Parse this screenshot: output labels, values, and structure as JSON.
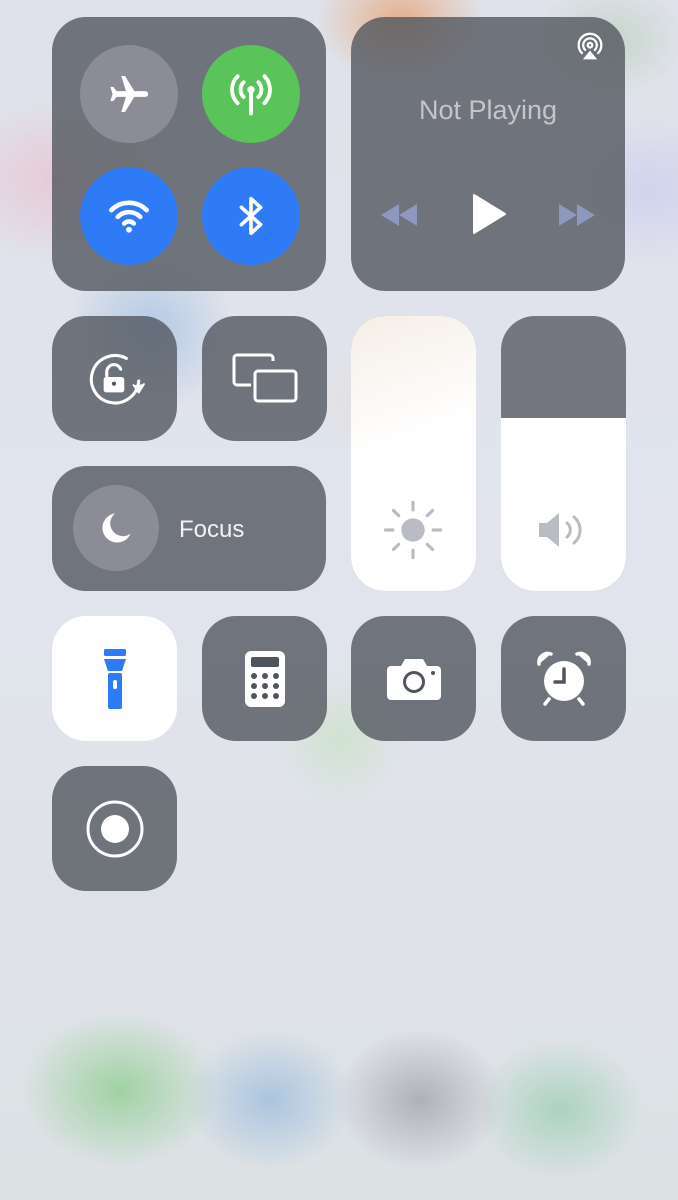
{
  "connectivity": {
    "airplane_mode": false,
    "cellular_data": true,
    "wifi": true,
    "bluetooth": true
  },
  "now_playing": {
    "title": "Not Playing"
  },
  "focus": {
    "label": "Focus"
  },
  "brightness": {
    "level": 1.0
  },
  "volume": {
    "level": 0.63
  },
  "flashlight": {
    "on": true
  },
  "colors": {
    "tile_bg": "#50545C",
    "airplane_off": "#8C8C96",
    "cellular_on": "#5AC35A",
    "accent_blue": "#2F7BF5",
    "flashlight_icon": "#2F7BF5"
  },
  "icons": {
    "airplane": "airplane-icon",
    "cellular": "cellular-antenna-icon",
    "wifi": "wifi-icon",
    "bluetooth": "bluetooth-icon",
    "airplay": "airplay-audio-icon",
    "rewind": "rewind-icon",
    "play": "play-icon",
    "fast_forward": "fast-forward-icon",
    "rotation_lock": "rotation-lock-icon",
    "screen_mirroring": "screen-mirroring-icon",
    "moon": "moon-icon",
    "brightness": "sun-icon",
    "volume": "speaker-icon",
    "flashlight": "flashlight-icon",
    "calculator": "calculator-icon",
    "camera": "camera-icon",
    "alarm": "alarm-clock-icon",
    "screen_record": "screen-record-icon"
  }
}
